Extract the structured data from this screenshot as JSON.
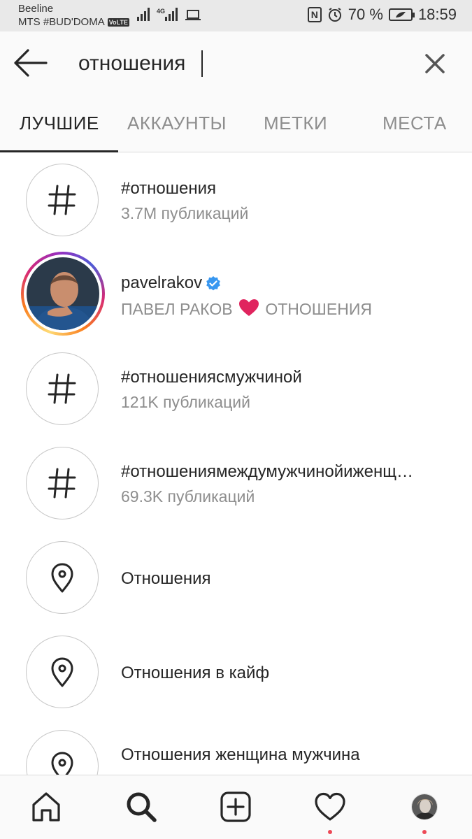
{
  "status_bar": {
    "carrier1": "Beeline",
    "carrier2": "MTS #BUD'DOMA",
    "volte": "VoLTE",
    "network": "4G",
    "battery": "70 %",
    "time": "18:59"
  },
  "search": {
    "query": "отношения"
  },
  "tabs": [
    {
      "label": "ЛУЧШИЕ",
      "active": true
    },
    {
      "label": "АККАУНТЫ",
      "active": false
    },
    {
      "label": "МЕТКИ",
      "active": false
    },
    {
      "label": "МЕСТА",
      "active": false
    }
  ],
  "results": [
    {
      "type": "hashtag",
      "title": "#отношения",
      "subtitle": "3.7M публикаций",
      "icon": "hashtag-icon"
    },
    {
      "type": "account",
      "title": "pavelrakov",
      "verified": true,
      "subtitle_before": "ПАВЕЛ РАКОВ",
      "subtitle_after": "ОТНОШЕНИЯ",
      "icon": "avatar"
    },
    {
      "type": "hashtag",
      "title": "#отношениясмужчиной",
      "subtitle": "121K публикаций",
      "icon": "hashtag-icon"
    },
    {
      "type": "hashtag",
      "title": "#отношениямеждумужчинойиженщ…",
      "subtitle": "69.3K публикаций",
      "icon": "hashtag-icon"
    },
    {
      "type": "place",
      "title": "Отношения",
      "icon": "location-pin-icon"
    },
    {
      "type": "place",
      "title": "Отношения в кайф",
      "icon": "location-pin-icon"
    },
    {
      "type": "place",
      "title": "Отношения женщина мужчина",
      "icon": "location-pin-icon"
    }
  ],
  "bottom_nav": [
    {
      "name": "home-icon"
    },
    {
      "name": "search-icon",
      "active": true
    },
    {
      "name": "new-post-icon"
    },
    {
      "name": "activity-heart-icon",
      "notification": true
    },
    {
      "name": "profile-avatar",
      "notification": true
    }
  ],
  "colors": {
    "text": "#262626",
    "secondary": "#8e8e8e",
    "verified": "#3897f0",
    "notification": "#ed4956",
    "heart": "#e0245e"
  }
}
